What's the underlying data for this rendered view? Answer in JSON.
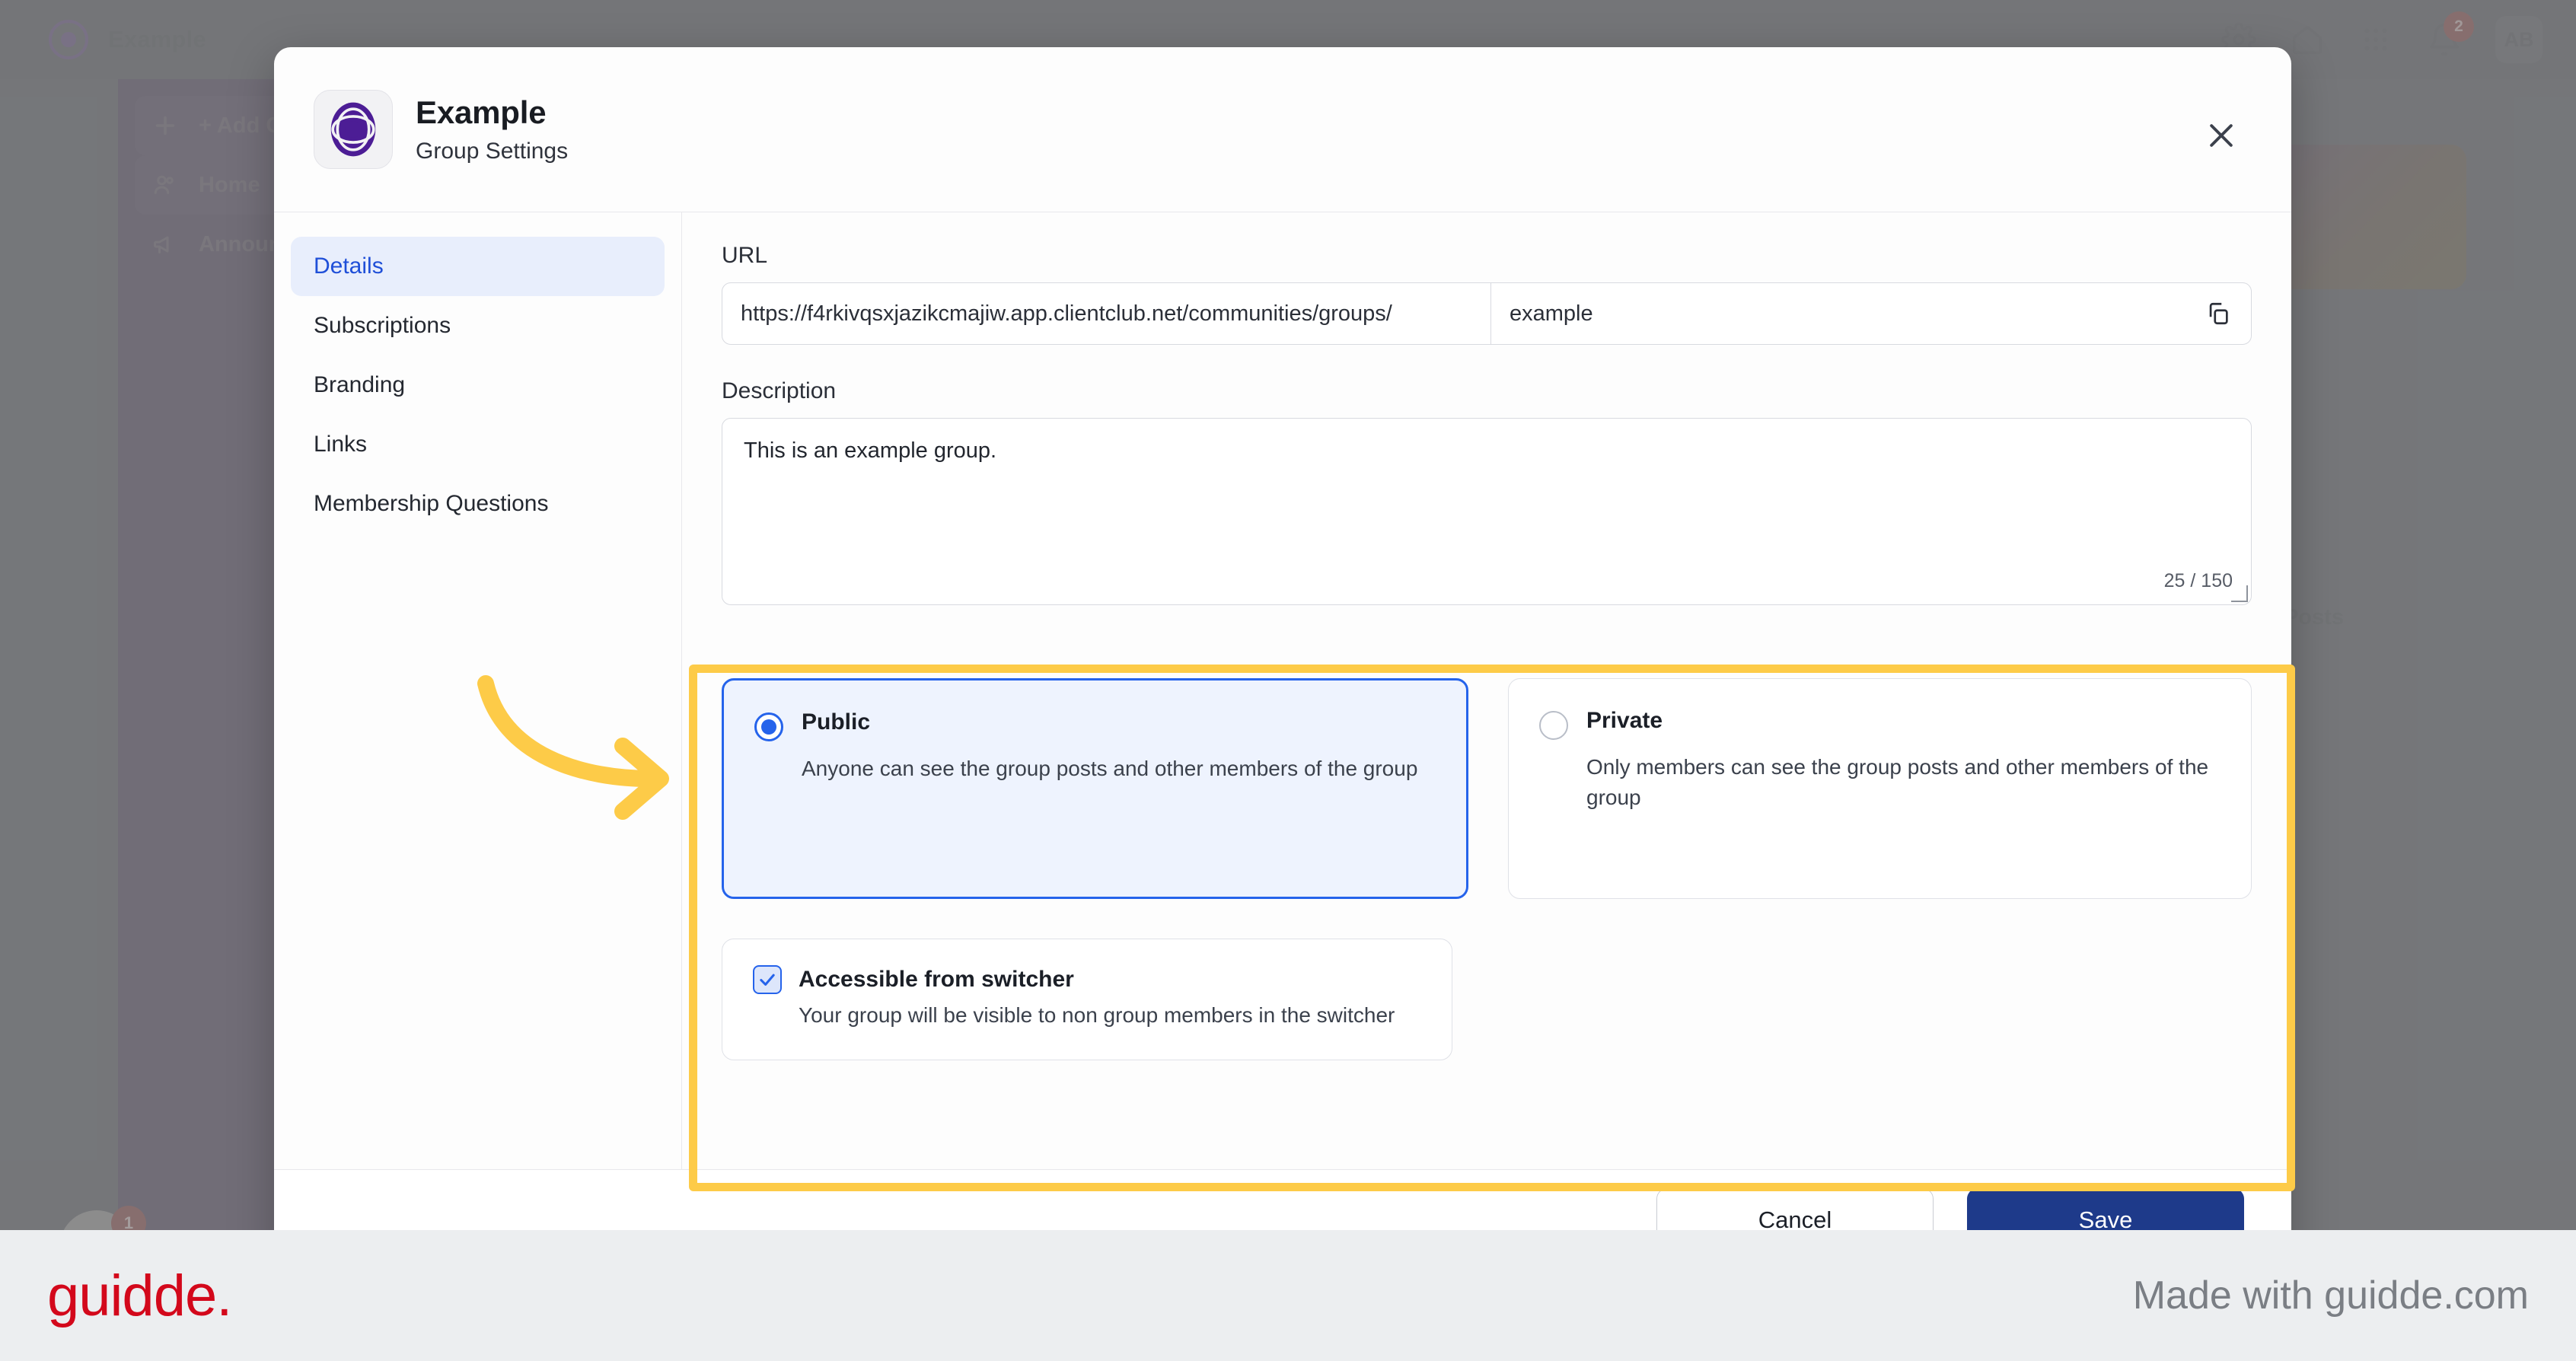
{
  "background": {
    "topbar": {
      "brand_label": "Example",
      "icons": [
        "gear-icon",
        "home-icon",
        "apps-grid-icon",
        "bell-icon"
      ],
      "notification_count": "2",
      "avatar_initials": "AB"
    },
    "left_rail": [
      {
        "label": "+ Add Chan",
        "icon": "plus-icon"
      },
      {
        "label": "Home",
        "icon": "people-icon"
      },
      {
        "label": "Announc",
        "icon": "megaphone-icon"
      }
    ],
    "posts_label": "Posts",
    "avatar_badge": "1"
  },
  "modal": {
    "title": "Example",
    "subtitle": "Group Settings",
    "close_label": "×",
    "sidebar": {
      "items": [
        {
          "label": "Details",
          "active": true
        },
        {
          "label": "Subscriptions",
          "active": false
        },
        {
          "label": "Branding",
          "active": false
        },
        {
          "label": "Links",
          "active": false
        },
        {
          "label": "Membership Questions",
          "active": false
        }
      ]
    },
    "url": {
      "label": "URL",
      "prefix": "https://f4rkivqsxjazikcmajiw.app.clientclub.net/communities/groups/",
      "value": "example",
      "copy_icon": "copy-icon"
    },
    "description": {
      "label": "Description",
      "value": "This is an example group.",
      "counter": "25 / 150"
    },
    "visibility": {
      "options": [
        {
          "title": "Public",
          "description": "Anyone can see the group posts and other members of the group",
          "selected": true
        },
        {
          "title": "Private",
          "description": "Only members can see the group posts and other members of the group",
          "selected": false
        }
      ],
      "switcher": {
        "title": "Accessible from switcher",
        "description": "Your group will be visible to non group members in the switcher",
        "checked": true
      }
    },
    "footer": {
      "cancel_label": "Cancel",
      "save_label": "Save"
    }
  },
  "annotation": {
    "arrow_color": "#fdcb48",
    "highlight_color": "#fdcb48"
  },
  "guidde": {
    "logo": "guidde.",
    "made_with": "Made with guidde.com"
  }
}
